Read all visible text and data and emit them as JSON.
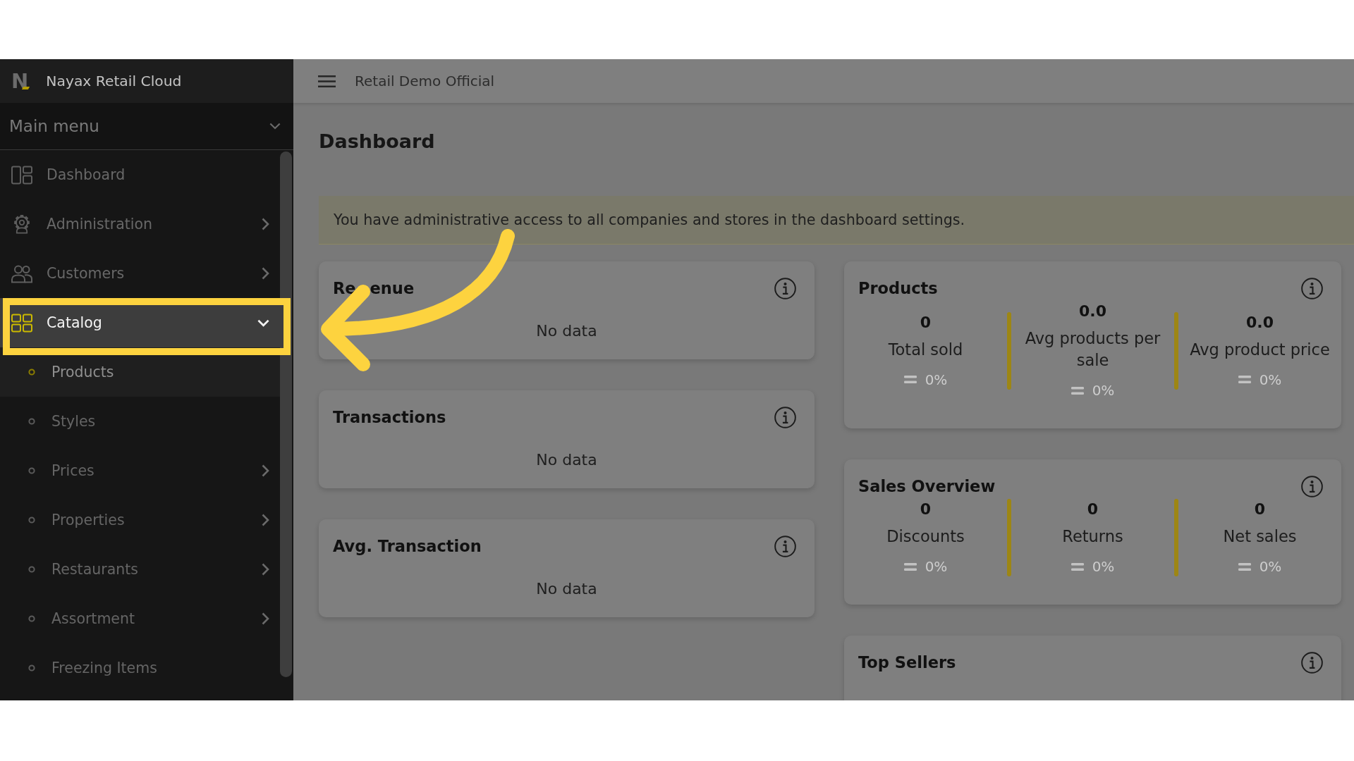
{
  "sidebar": {
    "brand": {
      "logo_mark": "N",
      "name": "Nayax Retail Cloud"
    },
    "menu": {
      "title": "Main menu",
      "expanded": true
    },
    "items": [
      {
        "label": "Dashboard",
        "has_submenu": false,
        "selected": false,
        "highlighted": false
      },
      {
        "label": "Administration",
        "has_submenu": true,
        "expanded": false,
        "selected": false,
        "highlighted": false
      },
      {
        "label": "Customers",
        "has_submenu": true,
        "expanded": false,
        "selected": false,
        "highlighted": false
      },
      {
        "label": "Catalog",
        "has_submenu": true,
        "expanded": true,
        "selected": true,
        "highlighted": true,
        "children": [
          {
            "label": "Products",
            "has_submenu": false,
            "selected": true
          },
          {
            "label": "Styles",
            "has_submenu": false,
            "selected": false
          },
          {
            "label": "Prices",
            "has_submenu": true,
            "expanded": false,
            "selected": false
          },
          {
            "label": "Properties",
            "has_submenu": true,
            "expanded": false,
            "selected": false
          },
          {
            "label": "Restaurants",
            "has_submenu": true,
            "expanded": false,
            "selected": false
          },
          {
            "label": "Assortment",
            "has_submenu": true,
            "expanded": false,
            "selected": false
          },
          {
            "label": "Freezing Items",
            "has_submenu": false,
            "selected": false
          }
        ]
      }
    ]
  },
  "topbar": {
    "title": "Retail Demo Official"
  },
  "page": {
    "title": "Dashboard",
    "notice": "You have administrative access to all companies and stores in the dashboard settings.",
    "columns": [
      {
        "cards": [
          {
            "kind": "empty",
            "title_parts": [
              "Re",
              "enue"
            ],
            "message": "No data"
          },
          {
            "kind": "empty",
            "title": "Transactions",
            "message": "No data"
          },
          {
            "kind": "empty",
            "title": "Avg. Transaction",
            "message": "No data"
          }
        ]
      },
      {
        "cards": [
          {
            "kind": "stats",
            "title": "Products",
            "stats": [
              {
                "kind": "flat",
                "value": "0",
                "label": "Total sold",
                "change": "0%"
              },
              {
                "kind": "flat",
                "value": "0.0",
                "label": "Avg products per sale",
                "change": "0%"
              },
              {
                "kind": "flat",
                "value": "0.0",
                "label": "Avg product price",
                "change": "0%"
              }
            ]
          },
          {
            "kind": "stats",
            "title": "Sales Overview",
            "stats": [
              {
                "kind": "flat",
                "value": "0",
                "label": "Discounts",
                "change": "0%"
              },
              {
                "kind": "flat",
                "value": "0",
                "label": "Returns",
                "change": "0%"
              },
              {
                "kind": "flat",
                "value": "0",
                "label": "Net sales",
                "change": "0%"
              }
            ]
          },
          {
            "kind": "empty",
            "title": "Top Sellers"
          }
        ]
      }
    ]
  }
}
